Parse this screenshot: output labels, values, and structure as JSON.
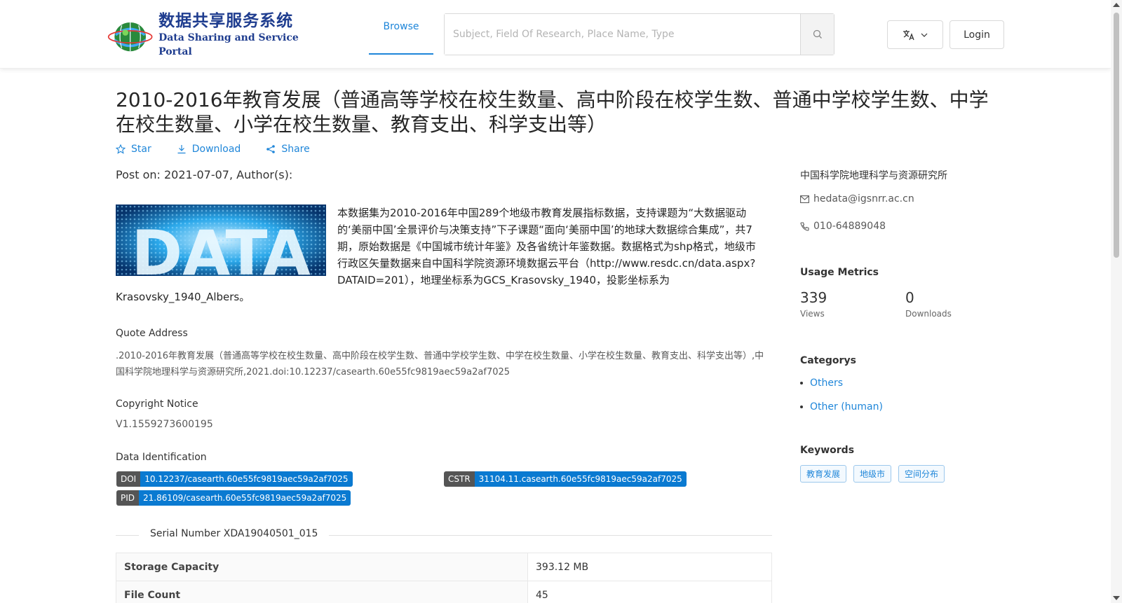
{
  "header": {
    "logo_cn": "数据共享服务系统",
    "logo_en": "Data Sharing and Service Portal",
    "nav_browse": "Browse",
    "search_placeholder": "Subject, Field Of Research, Place Name, Type",
    "login": "Login"
  },
  "dataset": {
    "title": "2010-2016年教育发展（普通高等学校在校生数量、高中阶段在校学生数、普通中学校学生数、中学在校生数量、小学在校生数量、教育支出、科学支出等）",
    "actions": {
      "star": "Star",
      "download": "Download",
      "share": "Share"
    },
    "post_on": "Post on: 2021-07-07, Author(s):",
    "thumbnail_text": "DATA",
    "description": "本数据集为2010-2016年中国289个地级市教育发展指标数据，支持课题为“大数据驱动的‘美丽中国’全景评价与决策支持”下子课题“面向‘美丽中国’的地球大数据综合集成”，共7期，原始数据是《中国城市统计年鉴》及各省统计年鉴数据。数据格式为shp格式，地级市行政区矢量数据来自中国科学院资源环境数据云平台（http://www.resdc.cn/data.aspx?DATAID=201），地理坐标系为GCS_Krasovsky_1940，投影坐标系为Krasovsky_1940_Albers。",
    "quote_heading": "Quote Address",
    "quote_text": ".2010-2016年教育发展（普通高等学校在校生数量、高中阶段在校学生数、普通中学校学生数、中学在校生数量、小学在校生数量、教育支出、科学支出等）,中国科学院地理科学与资源研究所,2021.doi:10.12237/casearth.60e55fc9819aec59a2af7025",
    "copyright_heading": "Copyright Notice",
    "copyright_value": "V1.1559273600195",
    "identification_heading": "Data Identification",
    "doi_key": "DOI",
    "doi_value": "10.12237/casearth.60e55fc9819aec59a2af7025",
    "cstr_key": "CSTR",
    "cstr_value": "31104.11.casearth.60e55fc9819aec59a2af7025",
    "pid_key": "PID",
    "pid_value": "21.86109/casearth.60e55fc9819aec59a2af7025",
    "serial": "Serial Number XDA19040501_015",
    "table": [
      {
        "key": "Storage Capacity",
        "value": "393.12 MB"
      },
      {
        "key": "File Count",
        "value": "45"
      }
    ]
  },
  "sidebar": {
    "org": "中国科学院地理科学与资源研究所",
    "email": "hedata@igsnrr.ac.cn",
    "phone": "010-64889048",
    "metrics_heading": "Usage Metrics",
    "views_count": "339",
    "views_label": "Views",
    "downloads_count": "0",
    "downloads_label": "Downloads",
    "categories_heading": "Categorys",
    "categories": [
      "Others",
      "Other (human)"
    ],
    "keywords_heading": "Keywords",
    "keywords": [
      "教育发展",
      "地级市",
      "空间分布"
    ]
  },
  "colors": {
    "accent": "#1f86d9",
    "badge_value": "#0a7ad1",
    "badge_key": "#555555"
  }
}
